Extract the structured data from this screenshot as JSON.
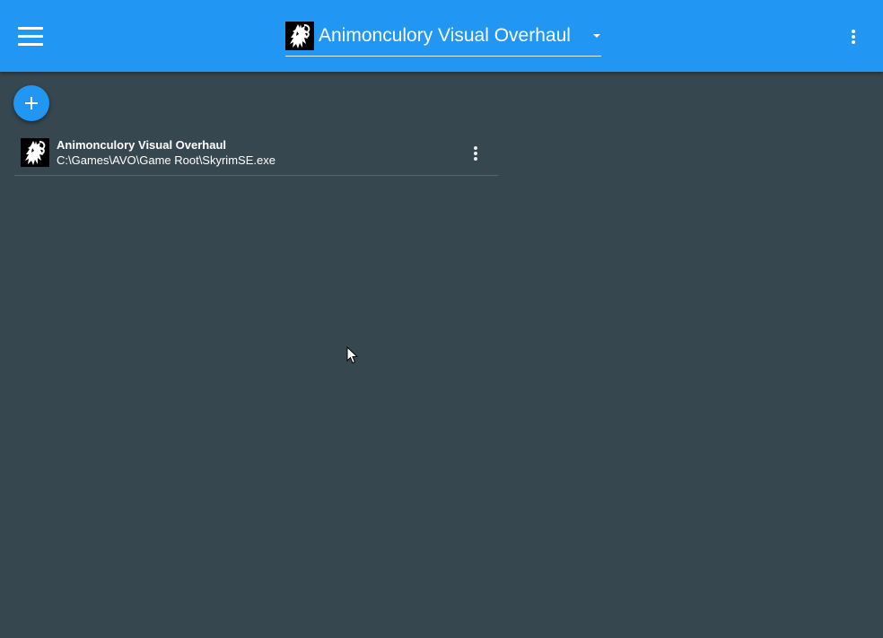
{
  "header": {
    "menu_icon": "hamburger-menu-icon",
    "selected_profile": "Animonculory Visual Overhaul",
    "profile_icon": "skyrim-dragon-logo-icon",
    "dropdown_icon": "caret-down-icon",
    "overflow_icon": "more-vertical-icon"
  },
  "actions": {
    "add_icon": "plus-icon"
  },
  "profiles": [
    {
      "name": "Animonculory Visual Overhaul",
      "path": "C:\\Games\\AVO\\Game Root\\SkyrimSE.exe",
      "icon": "skyrim-dragon-logo-icon",
      "menu_icon": "more-vertical-icon"
    }
  ],
  "colors": {
    "app_bar": "#2196f3",
    "background": "#37474f",
    "accent": "#2196f3",
    "text": "#ffffff"
  }
}
